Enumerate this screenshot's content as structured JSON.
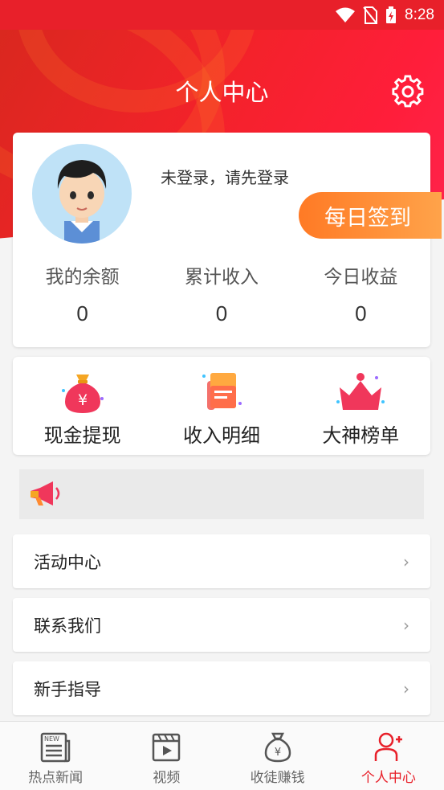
{
  "status_bar": {
    "time": "8:28"
  },
  "header": {
    "title": "个人中心"
  },
  "profile": {
    "login_prompt": "未登录，请先登录",
    "checkin_label": "每日签到",
    "stats": [
      {
        "label": "我的余额",
        "value": "0"
      },
      {
        "label": "累计收入",
        "value": "0"
      },
      {
        "label": "今日收益",
        "value": "0"
      }
    ]
  },
  "quick_actions": [
    {
      "label": "现金提现",
      "icon": "money-bag-icon"
    },
    {
      "label": "收入明细",
      "icon": "receipt-icon"
    },
    {
      "label": "大神榜单",
      "icon": "crown-icon"
    }
  ],
  "menu": [
    {
      "label": "活动中心"
    },
    {
      "label": "联系我们"
    },
    {
      "label": "新手指导"
    }
  ],
  "tabbar": [
    {
      "label": "热点新闻",
      "icon": "newspaper-icon",
      "active": false
    },
    {
      "label": "视频",
      "icon": "video-icon",
      "active": false
    },
    {
      "label": "收徒赚钱",
      "icon": "money-bag-icon",
      "active": false
    },
    {
      "label": "个人中心",
      "icon": "person-add-icon",
      "active": true
    }
  ],
  "colors": {
    "primary": "#e8202a",
    "accent": "#ff8a30",
    "background": "#f4f4f4"
  }
}
